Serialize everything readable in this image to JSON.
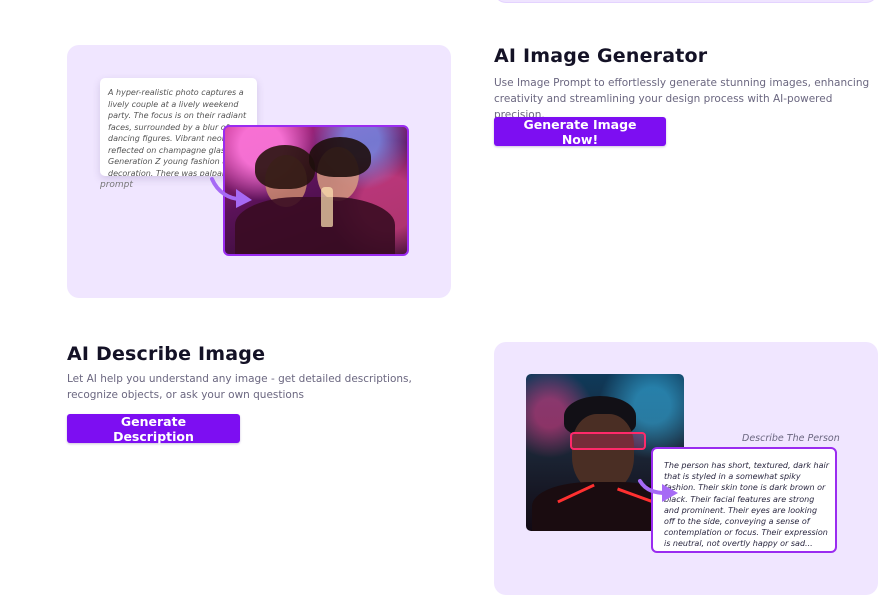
{
  "image_generator": {
    "title": "AI Image Generator",
    "description": "Use Image Prompt to effortlessly generate stunning images, enhancing creativity and streamlining your design process with AI-powered precision.",
    "button_label": "Generate Image Now!",
    "prompt_text": "A hyper-realistic photo captures a lively couple at a lively weekend party. The focus is on their radiant faces, surrounded by a blur of dancing figures. Vibrant neon lights reflected on champagne glasses. Generation Z young fashion and decoration. There was palpable energy and joy.",
    "prompt_label": "prompt"
  },
  "describe_image": {
    "title": "AI Describe Image",
    "description": "Let AI help you understand any image - get detailed descriptions, recognize objects, or ask your own questions",
    "button_label": "Generate Description",
    "describe_label": "Describe The Person",
    "description_text": "The person has short, textured, dark hair that is styled in a somewhat spiky fashion. Their skin tone is dark brown or black. Their facial features are strong and prominent. Their eyes are looking off to the side, conveying a sense of contemplation or focus. Their expression is neutral, not overtly happy or sad..."
  },
  "colors": {
    "accent": "#7d0ef2",
    "card_background": "#f0e6ff",
    "frame_border": "#9a2cf0",
    "arrow": "#a66af5"
  },
  "icons": [
    "curved-arrow-icon",
    "curved-arrow-icon"
  ]
}
